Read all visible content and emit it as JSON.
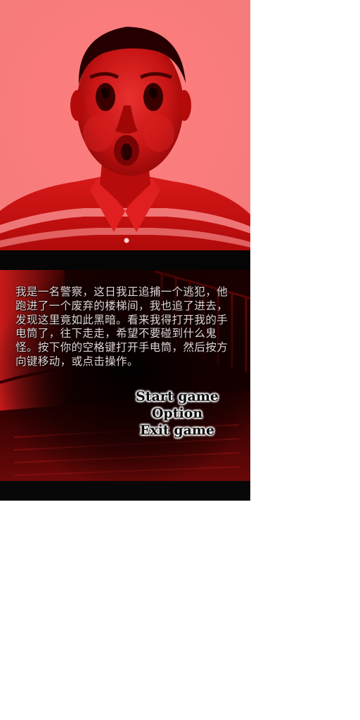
{
  "intro": {
    "text": "我是一名警察，这日我正追捕一个逃犯，他跑进了一个废弃的楼梯间，我也追了进去，发现这里竟如此黑暗。看来我得打开我的手电筒了，往下走走，希望不要碰到什么鬼怪。按下你的空格键打开手电筒，然后按方向键移动，或点击操作。"
  },
  "menu": {
    "items": [
      {
        "label": "Start game"
      },
      {
        "label": "Option"
      },
      {
        "label": "Exit game"
      }
    ]
  },
  "colors": {
    "tint": "#ff0000",
    "portrait_bg": "#ff8080",
    "text": "#e4d2d2",
    "menu_text": "#0a0a0a",
    "menu_glow": "#ffffff",
    "letterbox": "#050505"
  }
}
